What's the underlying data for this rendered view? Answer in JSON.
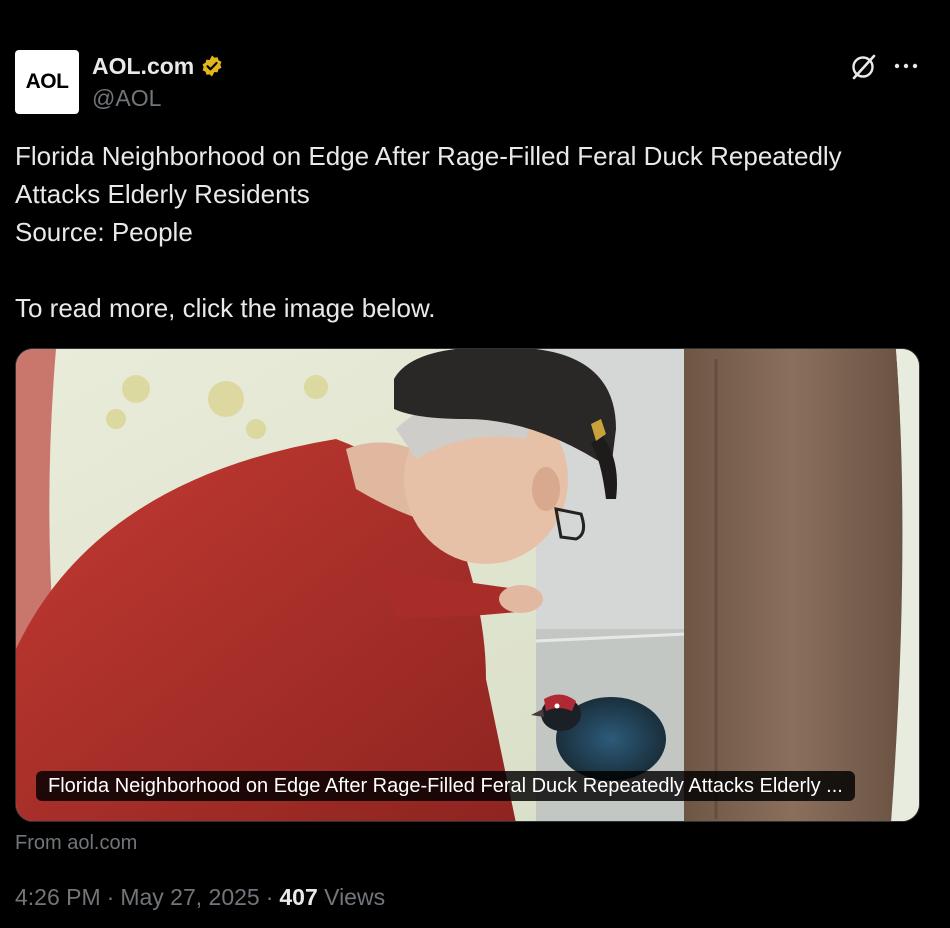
{
  "author": {
    "avatar_text": "AOL",
    "display_name": "AOL.com",
    "handle": "@AOL",
    "verified_icon": "gold-verified-badge-icon",
    "verified_color": "#e2b719"
  },
  "header_actions": {
    "grok_icon": "grok-icon",
    "more_icon": "more-horizontal-icon"
  },
  "tweet": {
    "line1": "Florida Neighborhood on Edge After Rage-Filled Feral Duck Repeatedly",
    "line2": "Attacks Elderly Residents",
    "line3": "Source: People",
    "line4": "To read more, click the image below."
  },
  "card": {
    "caption": "Florida Neighborhood on Edge After Rage-Filled Feral Duck Repeatedly Attacks Elderly ...",
    "source": "From aol.com"
  },
  "meta": {
    "time": "4:26 PM",
    "separator": "·",
    "date": "May 27, 2025",
    "views_count": "407",
    "views_label": "Views"
  },
  "colors": {
    "background": "#000000",
    "text": "#e7e9ea",
    "secondary_text": "#71767b"
  }
}
